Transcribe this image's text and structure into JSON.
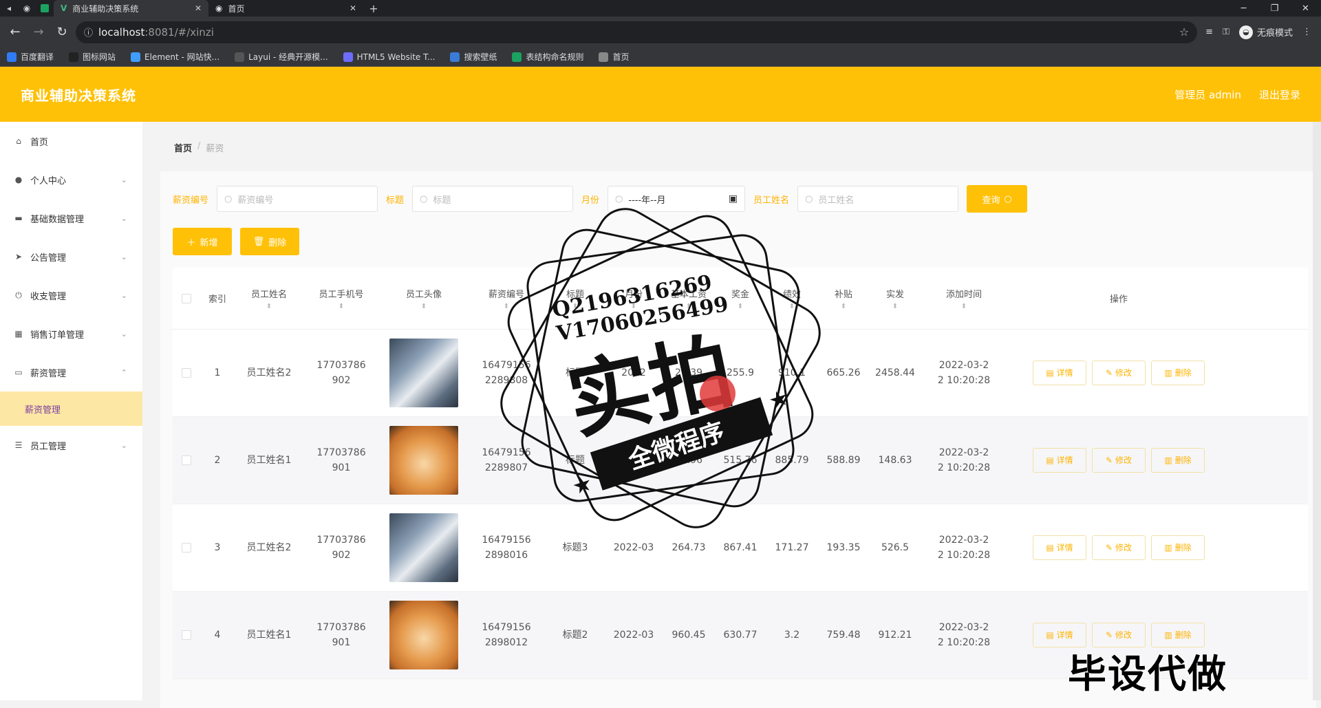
{
  "browser": {
    "tabs": [
      {
        "title": "商业辅助决策系统",
        "active": true
      },
      {
        "title": "首页",
        "active": false
      }
    ],
    "url_host": "localhost",
    "url_path": ":8081/#/xinzi",
    "incognito_label": "无痕模式",
    "bookmarks": [
      {
        "label": "百度翻译",
        "color": "#2f7cf6"
      },
      {
        "label": "图标网站",
        "color": "#222222"
      },
      {
        "label": "Element - 网站快...",
        "color": "#409eff"
      },
      {
        "label": "Layui - 经典开源模...",
        "color": "#555555"
      },
      {
        "label": "HTML5 Website T...",
        "color": "#6c6cff"
      },
      {
        "label": "搜索壁纸",
        "color": "#3a7bd5"
      },
      {
        "label": "表结构命名规则",
        "color": "#1aa260"
      },
      {
        "label": "首页",
        "color": "#888888"
      }
    ]
  },
  "app": {
    "title": "商业辅助决策系统",
    "user_label": "管理员 admin",
    "logout_label": "退出登录",
    "accent": "#ffc107"
  },
  "sidebar": {
    "items": [
      {
        "label": "首页",
        "icon": "home-icon",
        "expandable": false
      },
      {
        "label": "个人中心",
        "icon": "user-icon",
        "expandable": true
      },
      {
        "label": "基础数据管理",
        "icon": "monitor-icon",
        "expandable": true
      },
      {
        "label": "公告管理",
        "icon": "send-icon",
        "expandable": true
      },
      {
        "label": "收支管理",
        "icon": "power-icon",
        "expandable": true
      },
      {
        "label": "销售订单管理",
        "icon": "grid-icon",
        "expandable": true
      },
      {
        "label": "薪资管理",
        "icon": "card-icon",
        "expandable": true,
        "open": true
      },
      {
        "label": "员工管理",
        "icon": "list-icon",
        "expandable": true
      }
    ],
    "active_sub": "薪资管理"
  },
  "breadcrumb": {
    "home": "首页",
    "sep": "/",
    "current": "薪资"
  },
  "filters": [
    {
      "label": "薪资编号",
      "placeholder": "薪资编号"
    },
    {
      "label": "标题",
      "placeholder": "标题"
    },
    {
      "label": "月份",
      "value": "----年--月"
    },
    {
      "label": "员工姓名",
      "placeholder": "员工姓名"
    }
  ],
  "query_label": "查询",
  "add_label": "新增",
  "delete_label": "删除",
  "table": {
    "columns": [
      "索引",
      "员工姓名",
      "员工手机号",
      "员工头像",
      "薪资编号",
      "标题",
      "月份",
      "基本工资",
      "奖金",
      "绩效",
      "补贴",
      "实发",
      "添加时间",
      "操作"
    ],
    "rows": [
      {
        "idx": "1",
        "name": "员工姓名2",
        "phone_a": "17703786",
        "phone_b": "902",
        "avatar": "husky",
        "code_a": "16479156",
        "code_b": "2289808",
        "title": "标题",
        "month": "2022",
        "base": "27.39",
        "bonus": "255.9",
        "perf": "910.1",
        "subsidy": "665.26",
        "actual": "2458.44",
        "time_a": "2022-03-2",
        "time_b": "2 10:20:28"
      },
      {
        "idx": "2",
        "name": "员工姓名1",
        "phone_a": "17703786",
        "phone_b": "901",
        "avatar": "shiba",
        "code_a": "16479156",
        "code_b": "2289807",
        "title": "标题",
        "month": "",
        "base": "87.96",
        "bonus": "515.76",
        "perf": "885.79",
        "subsidy": "588.89",
        "actual": "148.63",
        "time_a": "2022-03-2",
        "time_b": "2 10:20:28"
      },
      {
        "idx": "3",
        "name": "员工姓名2",
        "phone_a": "17703786",
        "phone_b": "902",
        "avatar": "husky",
        "code_a": "16479156",
        "code_b": "2898016",
        "title": "标题3",
        "month": "2022-03",
        "base": "264.73",
        "bonus": "867.41",
        "perf": "171.27",
        "subsidy": "193.35",
        "actual": "526.5",
        "time_a": "2022-03-2",
        "time_b": "2 10:20:28"
      },
      {
        "idx": "4",
        "name": "员工姓名1",
        "phone_a": "17703786",
        "phone_b": "901",
        "avatar": "shiba",
        "code_a": "16479156",
        "code_b": "2898012",
        "title": "标题2",
        "month": "2022-03",
        "base": "960.45",
        "bonus": "630.77",
        "perf": "3.2",
        "subsidy": "759.48",
        "actual": "912.21",
        "time_a": "2022-03-2",
        "time_b": "2 10:20:28"
      }
    ],
    "op_labels": {
      "detail": "详情",
      "edit": "修改",
      "delete": "删除"
    }
  },
  "stamp": {
    "line1": "Q2196316269",
    "line2": "V17060256499",
    "big": "实拍",
    "ribbon": "全微程序"
  },
  "watermark": "毕设代做"
}
